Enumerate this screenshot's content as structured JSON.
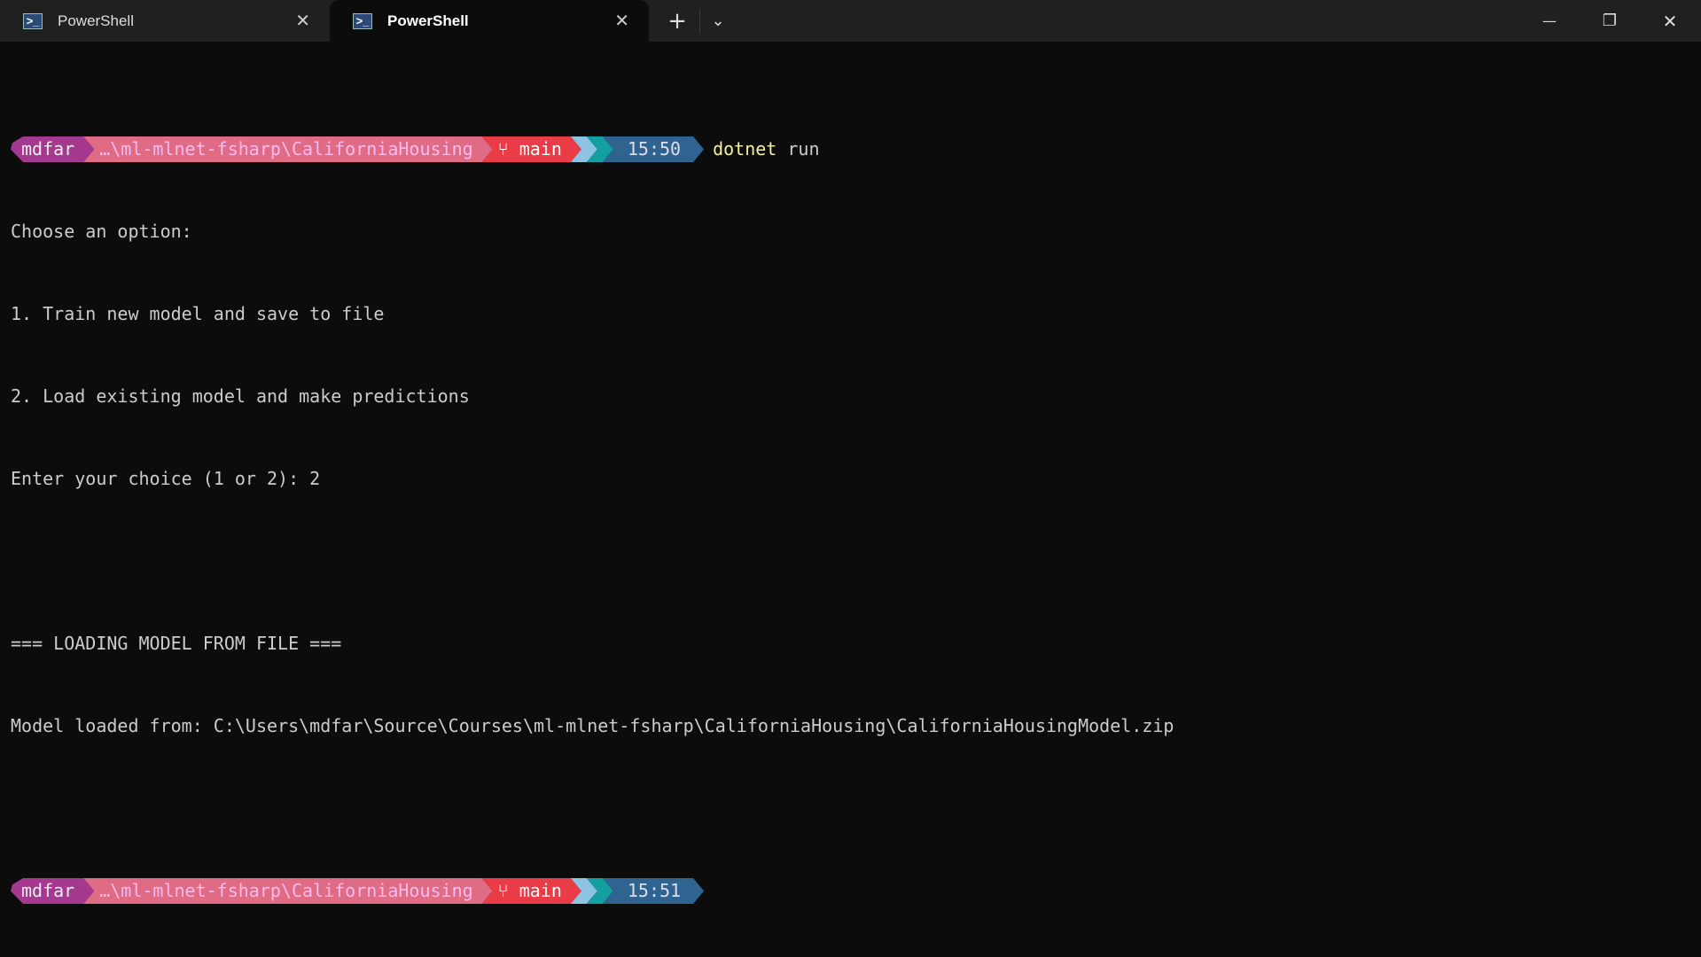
{
  "tabs": [
    {
      "title": "PowerShell",
      "icon": "powershell-icon"
    },
    {
      "title": "PowerShell",
      "icon": "powershell-icon",
      "active": true
    }
  ],
  "window": {
    "new_tab": "+",
    "dropdown": "⌄",
    "minimize": "—",
    "restore": "❐",
    "close": "✕"
  },
  "prompts": [
    {
      "user": "mdfar",
      "path": "…\\ml-mlnet-fsharp\\CaliforniaHousing",
      "branch": "main",
      "time": "15:50",
      "command": "dotnet",
      "args": " run"
    },
    {
      "user": "mdfar",
      "path": "…\\ml-mlnet-fsharp\\CaliforniaHousing",
      "branch": "main",
      "time": "15:51"
    }
  ],
  "output": [
    "Choose an option:",
    "1. Train new model and save to file",
    "2. Load existing model and make predictions",
    "Enter your choice (1 or 2): 2",
    "",
    "=== LOADING MODEL FROM FILE ===",
    "Model loaded from: C:\\Users\\mdfar\\Source\\Courses\\ml-mlnet-fsharp\\CaliforniaHousing\\CaliforniaHousingModel.zip"
  ],
  "colors": {
    "user": "#a4398f",
    "path": "#df6b84",
    "git": "#ea3c47",
    "time": "#2f6390",
    "command": "#f5f0a0"
  }
}
